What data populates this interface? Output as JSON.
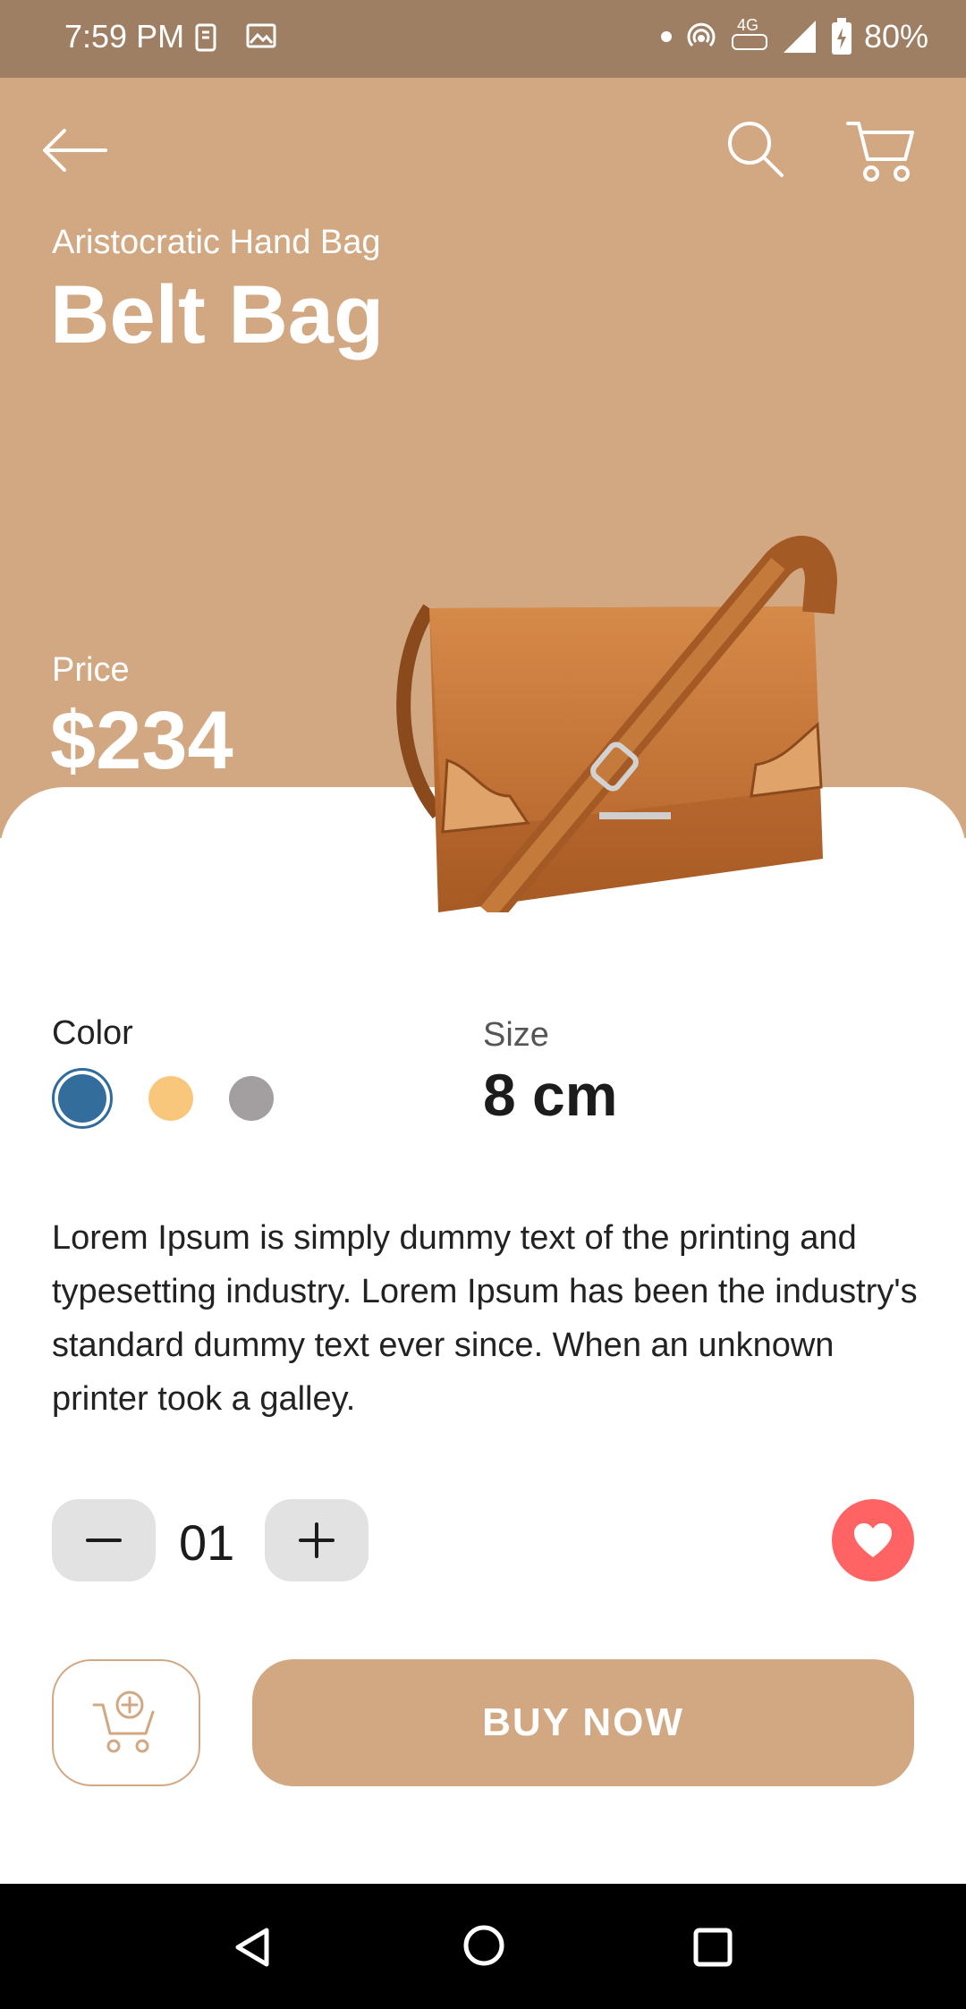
{
  "status_bar": {
    "time": "7:59 PM",
    "network": "4G",
    "battery": "80%"
  },
  "product": {
    "subtitle": "Aristocratic Hand Bag",
    "title": "Belt Bag",
    "price_label": "Price",
    "price": "$234"
  },
  "color": {
    "label": "Color",
    "options": [
      "#336d9c",
      "#f8c77c",
      "#a39fa1"
    ],
    "selected_index": 0
  },
  "size": {
    "label": "Size",
    "value": "8 cm"
  },
  "description": "Lorem Ipsum is simply dummy text of the printing and typesetting industry. Lorem Ipsum has been the industry's standard dummy text ever since. When an unknown printer took a galley.",
  "quantity": {
    "value": "01"
  },
  "actions": {
    "buy_label": "BUY  NOW"
  },
  "colors": {
    "hero": "#d2a883",
    "status_bar": "#9f7f63",
    "favorite": "#ff6363"
  }
}
